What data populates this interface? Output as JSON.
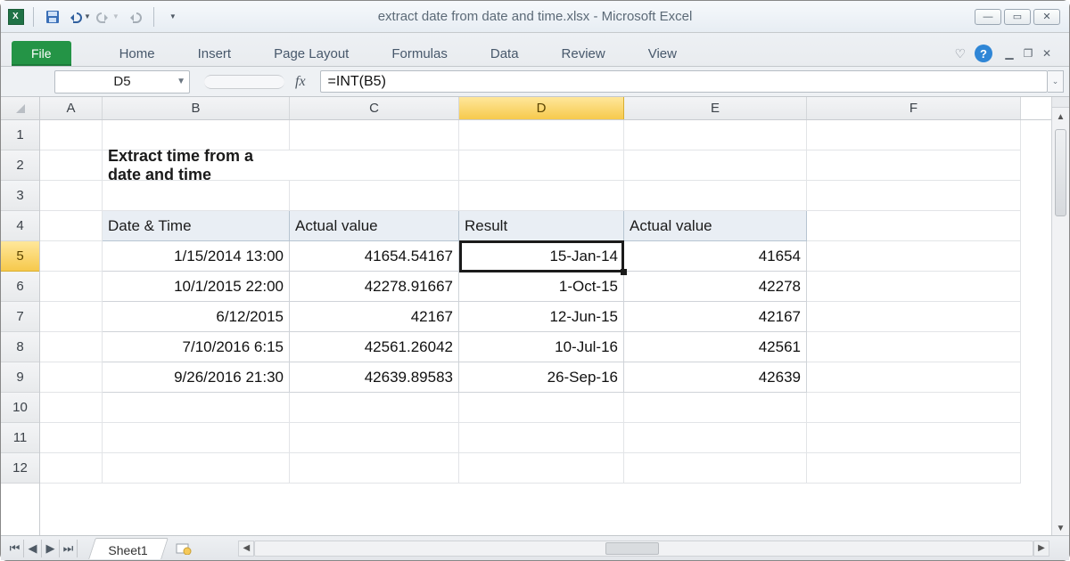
{
  "window": {
    "title": "extract date from date and time.xlsx  -  Microsoft Excel"
  },
  "qat": {
    "save": "💾",
    "undo": "↶",
    "redo": "↷",
    "undo2": "↶"
  },
  "menu": {
    "file": "File",
    "tabs": [
      "Home",
      "Insert",
      "Page Layout",
      "Formulas",
      "Data",
      "Review",
      "View"
    ]
  },
  "workbook_controls": {
    "min": "—",
    "restore": "❐",
    "close": "✕"
  },
  "formula_bar": {
    "cell_ref": "D5",
    "fx": "fx",
    "formula": "=INT(B5)"
  },
  "columns": [
    "A",
    "B",
    "C",
    "D",
    "E",
    "F"
  ],
  "selected_col": "D",
  "row_numbers": [
    1,
    2,
    3,
    4,
    5,
    6,
    7,
    8,
    9,
    10,
    11,
    12
  ],
  "selected_row": 5,
  "heading_row2": "Extract time from a date and time",
  "headers": {
    "b": "Date & Time",
    "c": "Actual value",
    "d": "Result",
    "e": "Actual value"
  },
  "rows": [
    {
      "b": "1/15/2014 13:00",
      "c": "41654.54167",
      "d": "15-Jan-14",
      "e": "41654"
    },
    {
      "b": "10/1/2015 22:00",
      "c": "42278.91667",
      "d": "1-Oct-15",
      "e": "42278"
    },
    {
      "b": "6/12/2015",
      "c": "42167",
      "d": "12-Jun-15",
      "e": "42167"
    },
    {
      "b": "7/10/2016 6:15",
      "c": "42561.26042",
      "d": "10-Jul-16",
      "e": "42561"
    },
    {
      "b": "9/26/2016 21:30",
      "c": "42639.89583",
      "d": "26-Sep-16",
      "e": "42639"
    }
  ],
  "sheet": {
    "name": "Sheet1"
  }
}
